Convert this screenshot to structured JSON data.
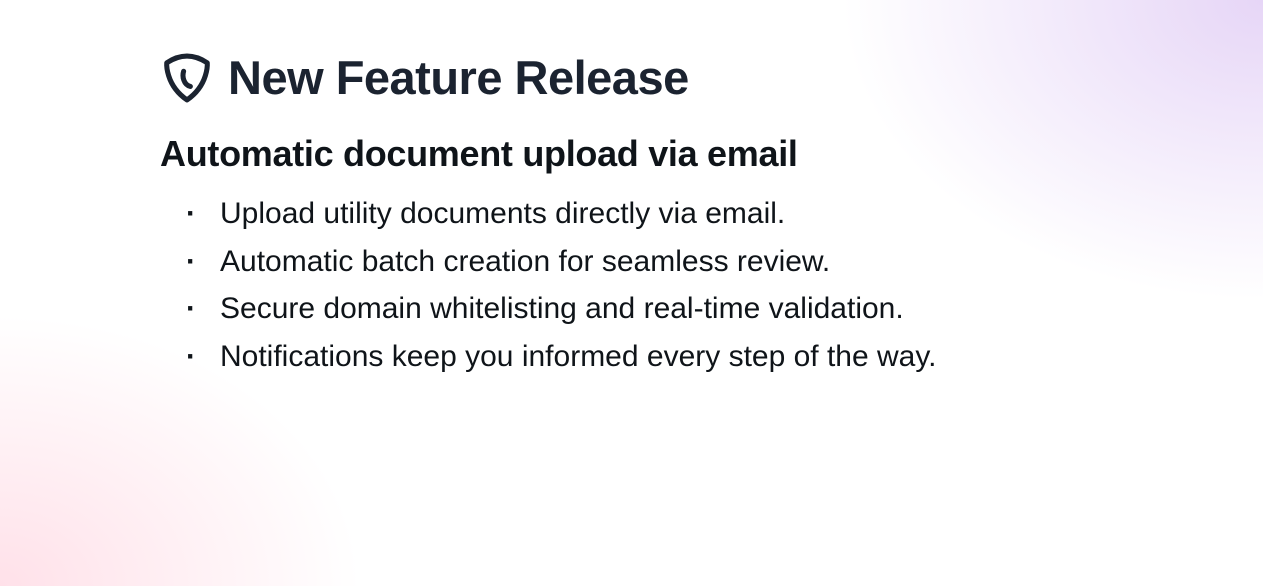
{
  "header": {
    "title": "New Feature Release"
  },
  "subtitle": "Automatic document upload via email",
  "bullets": [
    "Upload utility documents directly via email.",
    "Automatic batch creation for seamless review.",
    "Secure domain whitelisting and real-time validation.",
    "Notifications keep you informed every step of the way."
  ]
}
